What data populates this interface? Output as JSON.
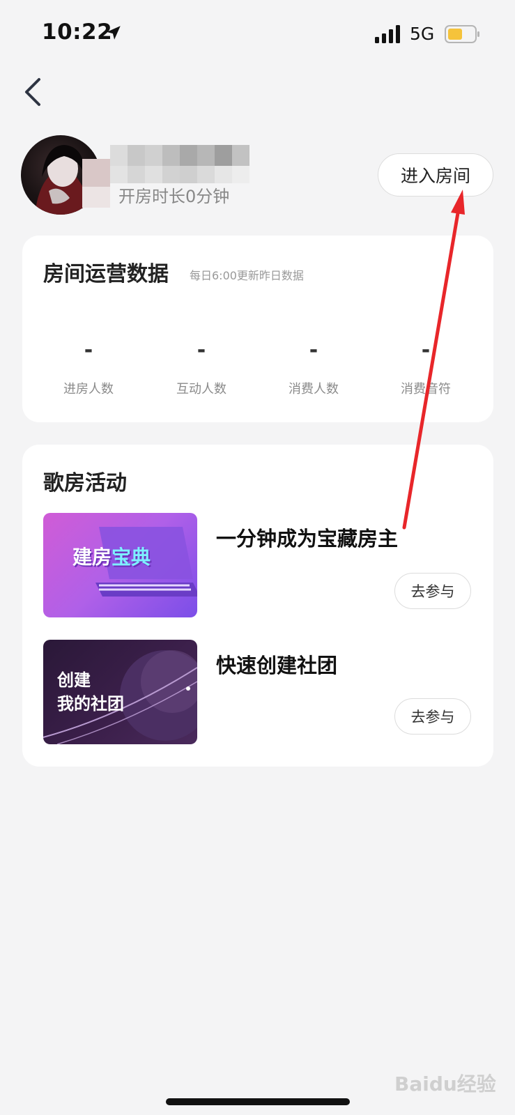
{
  "status_bar": {
    "time": "10:22",
    "network": "5G",
    "battery_color": "#f5c33b"
  },
  "header": {
    "subline": "开房时长0分钟",
    "enter_room_label": "进入房间"
  },
  "operations": {
    "title": "房间运营数据",
    "note": "每日6:00更新昨日数据",
    "stats": [
      {
        "value": "-",
        "label": "进房人数"
      },
      {
        "value": "-",
        "label": "互动人数"
      },
      {
        "value": "-",
        "label": "消费人数"
      },
      {
        "value": "-",
        "label": "消费音符"
      }
    ]
  },
  "activities": {
    "title": "歌房活动",
    "items": [
      {
        "title": "一分钟成为宝藏房主",
        "thumb_text": [
          "建房",
          "宝典"
        ],
        "button_label": "去参与"
      },
      {
        "title": "快速创建社团",
        "thumb_text": [
          "创建",
          "我的社团"
        ],
        "button_label": "去参与"
      }
    ]
  },
  "watermark": "Baidu经验",
  "colors": {
    "arrow": "#e8262a",
    "background": "#f4f4f5"
  }
}
